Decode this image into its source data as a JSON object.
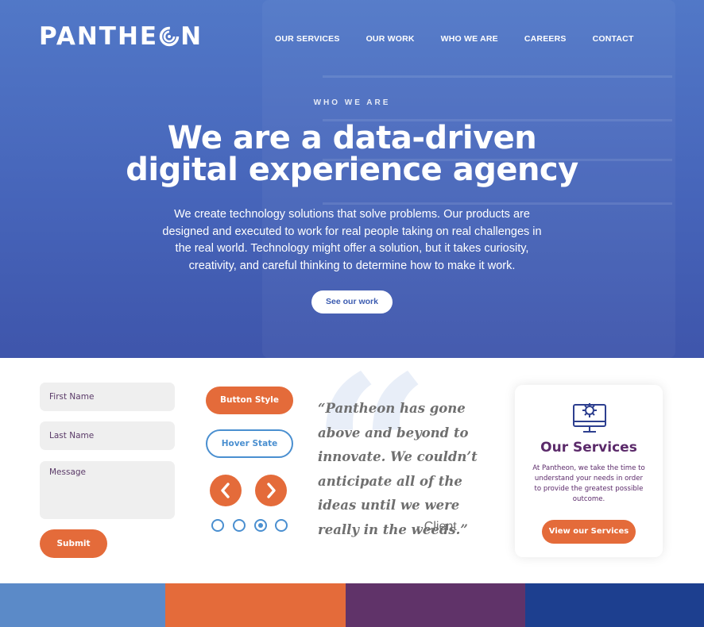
{
  "brand": {
    "logo_prefix": "PANTHE",
    "logo_suffix": "N",
    "logo_alt": "PANTHEON"
  },
  "nav": {
    "items": [
      {
        "label": "OUR SERVICES"
      },
      {
        "label": "OUR WORK"
      },
      {
        "label": "WHO WE ARE"
      },
      {
        "label": "CAREERS"
      },
      {
        "label": "CONTACT"
      }
    ]
  },
  "hero": {
    "eyebrow": "WHO WE ARE",
    "headline_line1": "We are a data-driven",
    "headline_line2": "digital experience agency",
    "lede": "We create technology solutions that solve problems.  Our products are designed and executed to work for real people taking on real challenges in the real world.  Technology might offer a solution, but it takes curiosity, creativity, and careful thinking to determine how to make it work.",
    "cta_label": "See our work"
  },
  "form": {
    "first_name_placeholder": "First Name",
    "last_name_placeholder": "Last Name",
    "message_placeholder": "Message",
    "submit_label": "Submit"
  },
  "buttons": {
    "primary_label": "Button Style",
    "hover_label": "Hover State",
    "prev_icon": "chevron-left-icon",
    "next_icon": "chevron-right-icon"
  },
  "carousel": {
    "slide_count": 4,
    "active_index": 2
  },
  "testimonial": {
    "quote": "“Pantheon has gone above and beyond to innovate. We couldn’t anticipate all of the ideas until we were really in the weeds.”",
    "cite": "- Client"
  },
  "services_card": {
    "icon": "monitor-gear-icon",
    "title": "Our Services",
    "text": "At Pantheon, we take the time to understand your needs in order to provide the greatest possible outcome.",
    "cta_label": "View our Services"
  },
  "palette": {
    "swatches": [
      "#5b8ac8",
      "#e46b3a",
      "#603369",
      "#1d3f8f"
    ]
  },
  "colors": {
    "accent_orange": "#e46b3a",
    "accent_blue": "#4a8fd0",
    "brand_purple": "#5b2a6a"
  }
}
